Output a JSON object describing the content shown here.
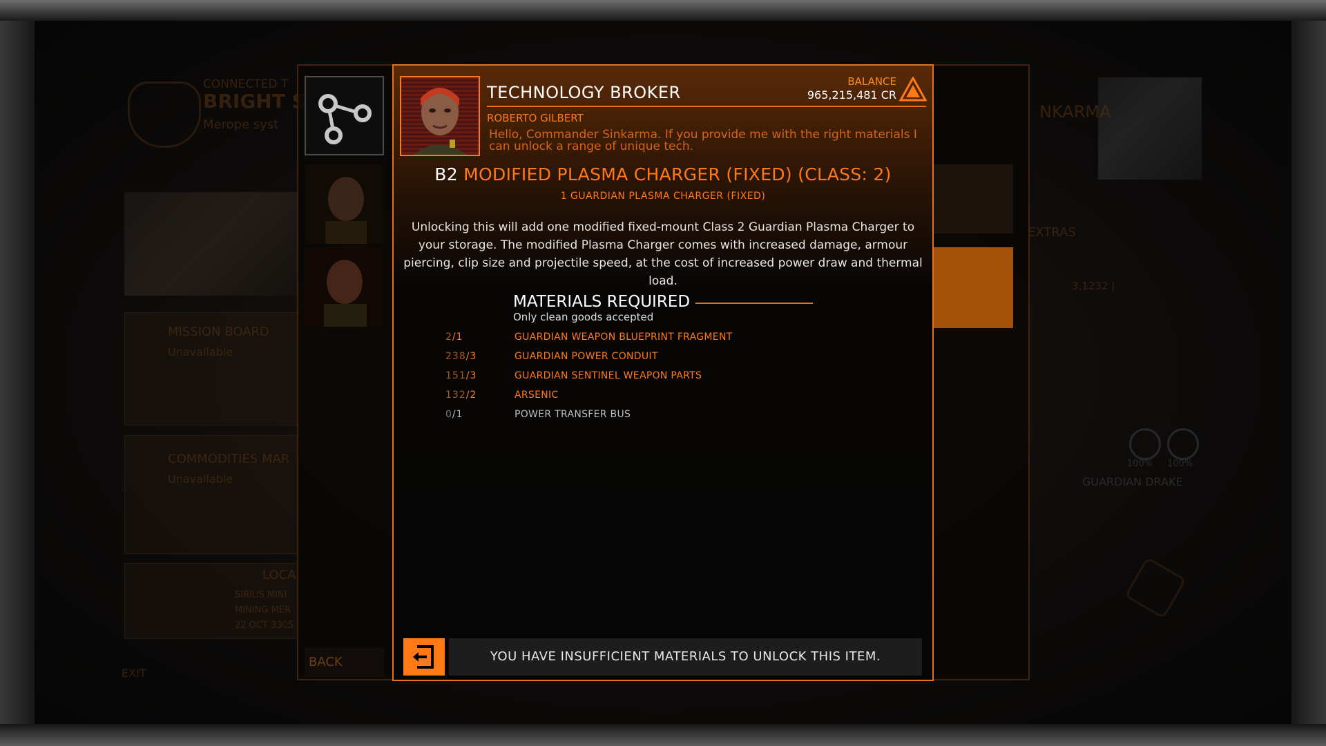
{
  "background": {
    "connected_label": "CONNECTED T",
    "station_name": "BRIGHT S",
    "system_name": "Merope syst",
    "mission_board": {
      "title": "MISSION BOARD",
      "status": "Unavailable"
    },
    "commodities": {
      "title": "COMMODITIES MAR",
      "status": "Unavailable"
    },
    "local": {
      "title": "LOCA",
      "line1": "SIRIUS MINI",
      "line2": "MINING MER",
      "line3": "22 OCT 3305"
    },
    "exit_label": "EXIT",
    "right_name": "NKARMA",
    "extras_label": "EXTRAS",
    "ship_stats": "3,1232  |",
    "gauge1": "100%",
    "gauge2": "100%",
    "ship_name": "GUARDIAN DRAKE"
  },
  "nav": {
    "back_label": "BACK",
    "icon": "branch-network-icon"
  },
  "header": {
    "title": "TECHNOLOGY BROKER",
    "balance_label": "BALANCE",
    "balance_value": "965,215,481 CR",
    "broker_name": "ROBERTO GILBERT",
    "greeting": "Hello, Commander Sinkarma. If you provide me with the right materials I can unlock a range of unique tech."
  },
  "item": {
    "grade": "B2",
    "name": "MODIFIED PLASMA CHARGER (FIXED) (CLASS: 2)",
    "subtitle": "1 GUARDIAN PLASMA CHARGER (FIXED)",
    "description": "Unlocking this will add one modified fixed-mount Class 2 Guardian Plasma Charger to your storage. The modified Plasma Charger comes with increased damage, armour piercing, clip size and projectile speed, at the cost of increased power draw and thermal load."
  },
  "materials": {
    "heading": "MATERIALS REQUIRED",
    "subheading": "Only clean goods accepted",
    "items": [
      {
        "have": "2",
        "need": "/1",
        "name": "GUARDIAN WEAPON BLUEPRINT FRAGMENT",
        "sufficient": true
      },
      {
        "have": "238",
        "need": "/3",
        "name": "GUARDIAN POWER CONDUIT",
        "sufficient": true
      },
      {
        "have": "151",
        "need": "/3",
        "name": "GUARDIAN SENTINEL WEAPON PARTS",
        "sufficient": true
      },
      {
        "have": "132",
        "need": "/2",
        "name": "ARSENIC",
        "sufficient": true
      },
      {
        "have": "0",
        "need": "/1",
        "name": "POWER TRANSFER BUS",
        "sufficient": false
      }
    ]
  },
  "footer": {
    "status": "YOU HAVE INSUFFICIENT MATERIALS TO UNLOCK THIS ITEM.",
    "icon": "unlock-exit-icon"
  },
  "colors": {
    "accent": "#ff7a16",
    "frame": "#e8701a",
    "text": "#ffffff",
    "missing": "#bdbdbd"
  }
}
